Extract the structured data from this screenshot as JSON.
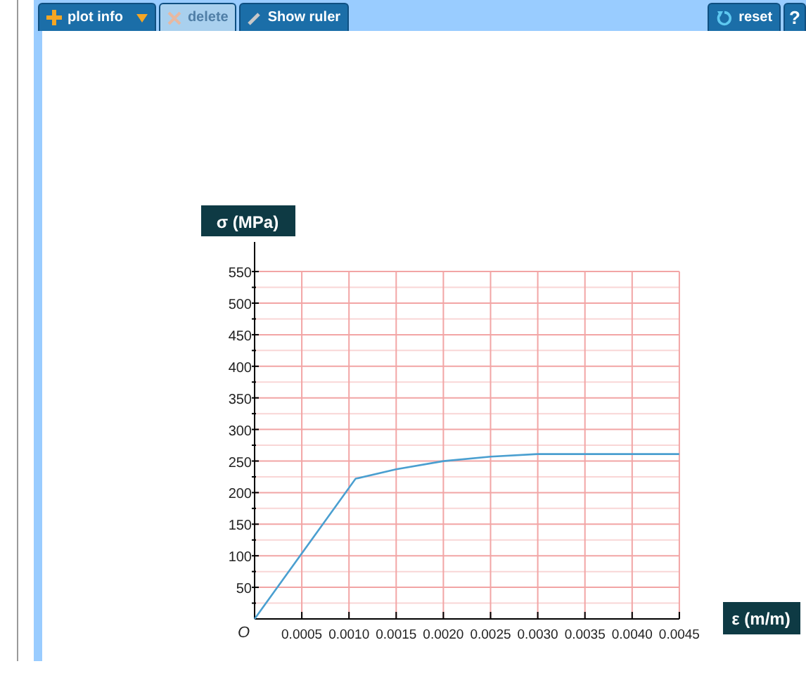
{
  "toolbar": {
    "left_buttons": [
      {
        "label": "plot info",
        "disabled": false,
        "has_menu": true
      },
      {
        "label": "delete",
        "disabled": true,
        "has_menu": false
      },
      {
        "label": "Show ruler",
        "disabled": false,
        "has_menu": false
      }
    ],
    "right_buttons": [
      {
        "label": "reset",
        "disabled": false
      },
      {
        "label": "?",
        "disabled": false
      }
    ]
  },
  "plot": {
    "origin_label": "O",
    "chart_data": {
      "type": "line",
      "xlabel": "ε (m/m)",
      "ylabel": "σ (MPa)",
      "x": [
        0,
        0.00107,
        0.0015,
        0.002,
        0.0025,
        0.003,
        0.0045
      ],
      "grid": true,
      "series": [
        {
          "color": "#4a9fd0",
          "values": [
            0,
            222,
            237,
            250,
            257,
            261,
            261
          ]
        }
      ],
      "xlim": [
        0,
        0.0045
      ],
      "ylim": [
        0,
        550
      ],
      "xticks": [
        {
          "value": 0.0005,
          "label": "0.0005"
        },
        {
          "value": 0.001,
          "label": "0.0010"
        },
        {
          "value": 0.0015,
          "label": "0.0015"
        },
        {
          "value": 0.002,
          "label": "0.0020"
        },
        {
          "value": 0.0025,
          "label": "0.0025"
        },
        {
          "value": 0.003,
          "label": "0.0030"
        },
        {
          "value": 0.0035,
          "label": "0.0035"
        },
        {
          "value": 0.004,
          "label": "0.0040"
        },
        {
          "value": 0.0045,
          "label": "0.0045"
        }
      ],
      "yticks": [
        50,
        100,
        150,
        200,
        250,
        300,
        350,
        400,
        450,
        500,
        550
      ]
    }
  }
}
